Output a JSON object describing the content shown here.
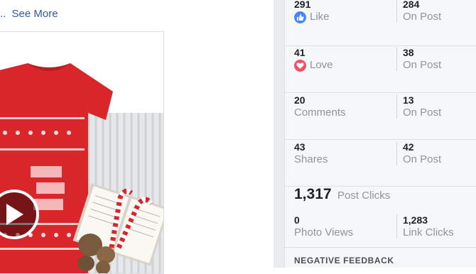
{
  "post": {
    "see_more_prefix": "..",
    "see_more": "See More"
  },
  "colors": {
    "link": "#365899",
    "like": "#4c84ff",
    "love": "#f25268",
    "shirt": "#d8262b"
  },
  "stats": [
    {
      "left_value": "291",
      "left_label": "Like",
      "left_icon": "like-icon",
      "right_value": "284",
      "right_label": "On Post"
    },
    {
      "left_value": "41",
      "left_label": "Love",
      "left_icon": "love-icon",
      "right_value": "38",
      "right_label": "On Post"
    },
    {
      "left_value": "20",
      "left_label": "Comments",
      "right_value": "13",
      "right_label": "On Post"
    },
    {
      "left_value": "43",
      "left_label": "Shares",
      "right_value": "42",
      "right_label": "On Post"
    }
  ],
  "clicks": {
    "total": "1,317",
    "total_label": "Post Clicks",
    "photo_views_value": "0",
    "photo_views_label": "Photo Views",
    "link_clicks_value": "1,283",
    "link_clicks_label": "Link Clicks"
  },
  "negative_feedback": {
    "title": "NEGATIVE FEEDBACK"
  }
}
